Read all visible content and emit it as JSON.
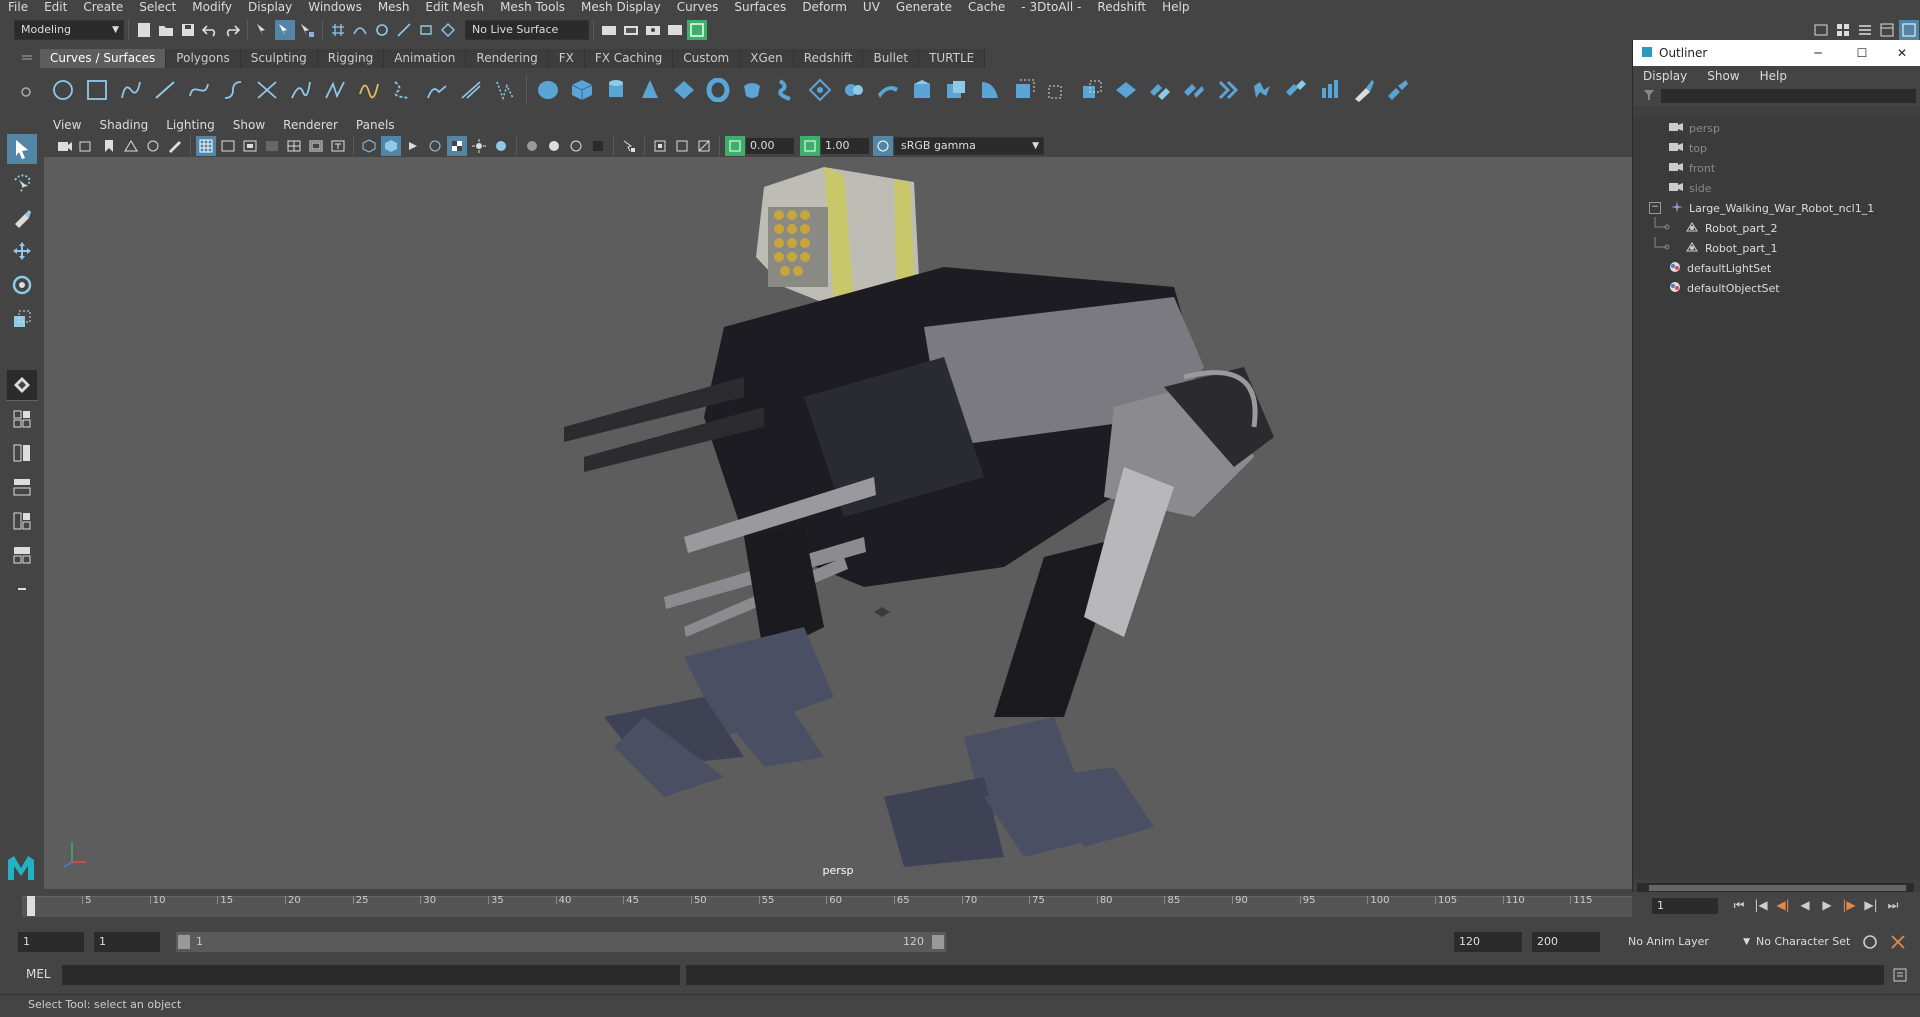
{
  "menubar": {
    "items": [
      "File",
      "Edit",
      "Create",
      "Select",
      "Modify",
      "Display",
      "Windows",
      "Mesh",
      "Edit Mesh",
      "Mesh Tools",
      "Mesh Display",
      "Curves",
      "Surfaces",
      "Deform",
      "UV",
      "Generate",
      "Cache",
      "- 3DtoAll -",
      "Redshift",
      "Help"
    ]
  },
  "statusline": {
    "mode": "Modeling",
    "live_surface": "No Live Surface"
  },
  "shelf": {
    "tabs": [
      "Curves / Surfaces",
      "Polygons",
      "Sculpting",
      "Rigging",
      "Animation",
      "Rendering",
      "FX",
      "FX Caching",
      "Custom",
      "XGen",
      "Redshift",
      "Bullet",
      "TURTLE"
    ],
    "active_tab": "Curves / Surfaces"
  },
  "panel": {
    "menus": [
      "View",
      "Shading",
      "Lighting",
      "Show",
      "Renderer",
      "Panels"
    ],
    "exposure": "0.00",
    "gamma": "1.00",
    "color_space": "sRGB gamma",
    "camera_label": "persp"
  },
  "outliner": {
    "title": "Outliner",
    "menus": [
      "Display",
      "Show",
      "Help"
    ],
    "items": [
      {
        "label": "persp",
        "icon": "camera-icon",
        "indent": 0,
        "dim": true
      },
      {
        "label": "top",
        "icon": "camera-icon",
        "indent": 0,
        "dim": true
      },
      {
        "label": "front",
        "icon": "camera-icon",
        "indent": 0,
        "dim": true
      },
      {
        "label": "side",
        "icon": "camera-icon",
        "indent": 0,
        "dim": true
      },
      {
        "label": "Large_Walking_War_Robot_ncl1_1",
        "icon": "joint-icon",
        "indent": 0,
        "dim": false,
        "expanded": true
      },
      {
        "label": "Robot_part_2",
        "icon": "mesh-icon",
        "indent": 1,
        "dim": false
      },
      {
        "label": "Robot_part_1",
        "icon": "mesh-icon",
        "indent": 1,
        "dim": false
      },
      {
        "label": "defaultLightSet",
        "icon": "set-icon",
        "indent": 0,
        "dim": false
      },
      {
        "label": "defaultObjectSet",
        "icon": "set-icon",
        "indent": 0,
        "dim": false
      }
    ]
  },
  "timeline": {
    "ticks": [
      "5",
      "10",
      "15",
      "20",
      "25",
      "30",
      "35",
      "40",
      "45",
      "50",
      "55",
      "60",
      "65",
      "70",
      "75",
      "80",
      "85",
      "90",
      "95",
      "100",
      "105",
      "110",
      "115"
    ],
    "current_start": "1",
    "current_frame": "1"
  },
  "range": {
    "start": "1",
    "playback_start": "1",
    "slider_start": "1",
    "slider_end": "120",
    "playback_end": "120",
    "end": "200",
    "anim_layer": "No Anim Layer",
    "character_set": "No Character Set"
  },
  "cmdline": {
    "label": "MEL"
  },
  "help": {
    "text": "Select Tool: select an object"
  }
}
